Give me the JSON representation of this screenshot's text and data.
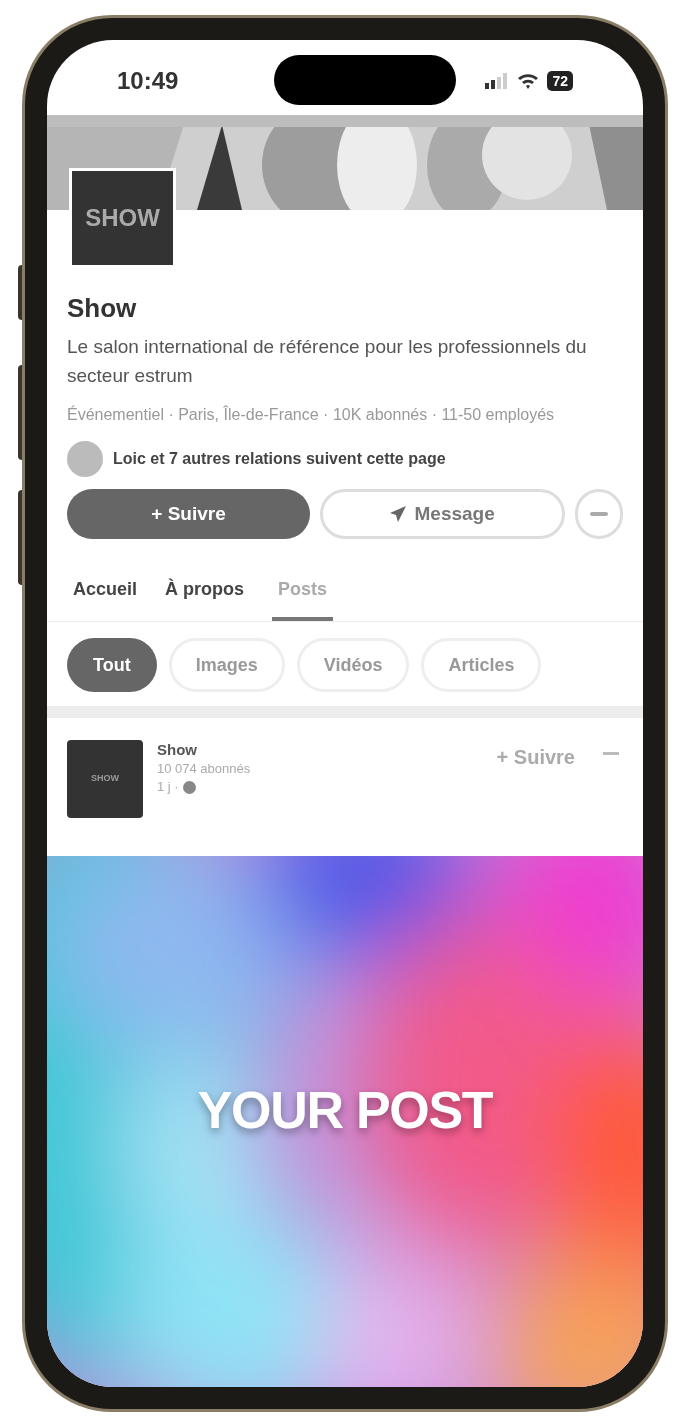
{
  "status_bar": {
    "time": "10:49",
    "battery": "72"
  },
  "company": {
    "logo_text": "SHOW",
    "name": "Show",
    "tagline": "Le salon international de référence pour les professionnels du secteur estrum",
    "meta": "Événementiel · Paris, Île-de-France · 10K abonnés · 11-50 employés",
    "relations": "Loic et 7 autres relations suivent cette page"
  },
  "actions": [
    {
      "kind": "primary",
      "label": "+ Suivre"
    },
    {
      "kind": "secondary",
      "label": "Message"
    },
    {
      "kind": "more"
    }
  ],
  "tabs": [
    {
      "label": "Accueil",
      "selected": false
    },
    {
      "label": "À propos",
      "selected": false
    },
    {
      "label": "Posts",
      "selected": true
    }
  ],
  "filters": [
    {
      "label": "Tout",
      "selected": true
    },
    {
      "label": "Images",
      "selected": false
    },
    {
      "label": "Vidéos",
      "selected": false
    },
    {
      "label": "Articles",
      "selected": false
    }
  ],
  "post": {
    "logo_text": "SHOW",
    "author": "Show",
    "followers": "10 074 abonnés",
    "time": "1 j ·",
    "follow": "+ Suivre",
    "image_text": "YOUR POST"
  }
}
